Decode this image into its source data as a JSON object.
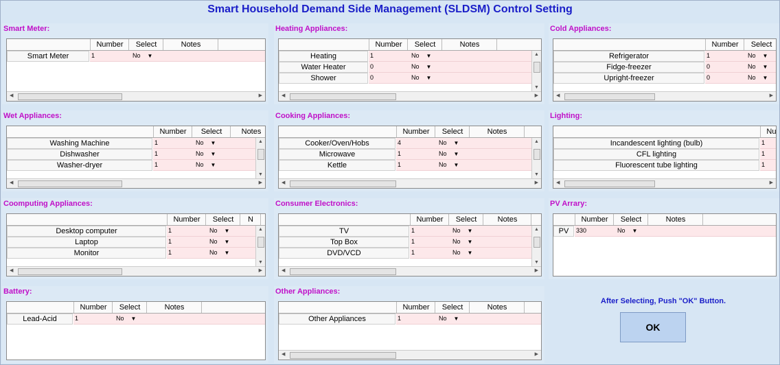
{
  "title": "Smart Household Demand Side Management (SLDSM) Control Setting",
  "columns": {
    "number": "Number",
    "select": "Select",
    "notes": "Notes"
  },
  "groups": [
    {
      "label": "Smart Meter:",
      "rows": [
        {
          "name": "Smart Meter",
          "number": "1",
          "select": "No"
        }
      ]
    },
    {
      "label": "Heating Appliances:",
      "rows": [
        {
          "name": "Heating",
          "number": "1",
          "select": "No"
        },
        {
          "name": "Water Heater",
          "number": "0",
          "select": "No"
        },
        {
          "name": "Shower",
          "number": "0",
          "select": "No"
        }
      ]
    },
    {
      "label": "Cold Appliances:",
      "rows": [
        {
          "name": "Refrigerator",
          "number": "1",
          "select": "No"
        },
        {
          "name": "Fidge-freezer",
          "number": "0",
          "select": "No"
        },
        {
          "name": "Upright-freezer",
          "number": "0",
          "select": "No"
        }
      ]
    },
    {
      "label": "Wet Appliances:",
      "rows": [
        {
          "name": "Washing Machine",
          "number": "1",
          "select": "No"
        },
        {
          "name": "Dishwasher",
          "number": "1",
          "select": "No"
        },
        {
          "name": "Washer-dryer",
          "number": "1",
          "select": "No"
        }
      ]
    },
    {
      "label": "Cooking Appliances:",
      "rows": [
        {
          "name": "Cooker/Oven/Hobs",
          "number": "4",
          "select": "No"
        },
        {
          "name": "Microwave",
          "number": "1",
          "select": "No"
        },
        {
          "name": "Kettle",
          "number": "1",
          "select": "No"
        }
      ]
    },
    {
      "label": "Lighting:",
      "rows": [
        {
          "name": "Incandescent lighting (bulb)",
          "number": "1",
          "select": ""
        },
        {
          "name": "CFL lighting",
          "number": "1",
          "select": ""
        },
        {
          "name": "Fluorescent tube lighting",
          "number": "1",
          "select": ""
        }
      ]
    },
    {
      "label": "Coomputing Appliances:",
      "rows": [
        {
          "name": "Desktop computer",
          "number": "1",
          "select": "No"
        },
        {
          "name": "Laptop",
          "number": "1",
          "select": "No"
        },
        {
          "name": "Monitor",
          "number": "1",
          "select": "No"
        }
      ]
    },
    {
      "label": "Consumer Electronics:",
      "rows": [
        {
          "name": "TV",
          "number": "1",
          "select": "No"
        },
        {
          "name": "Top Box",
          "number": "1",
          "select": "No"
        },
        {
          "name": "DVD/VCD",
          "number": "1",
          "select": "No"
        }
      ]
    },
    {
      "label": "PV Arrary:",
      "rows": [
        {
          "name": "PV",
          "number": "330",
          "select": "No"
        }
      ]
    },
    {
      "label": "Battery:",
      "rows": [
        {
          "name": "Lead-Acid",
          "number": "1",
          "select": "No"
        }
      ]
    },
    {
      "label": "Other Appliances:",
      "rows": [
        {
          "name": "Other Appliances",
          "number": "1",
          "select": "No"
        }
      ]
    }
  ],
  "lighting_number_header": "Num",
  "computing_notes_header": "N",
  "instruction": "After Selecting, Push \"OK\" Button.",
  "ok_label": "OK",
  "icons": {
    "dropdown": "dropdown-arrow-icon",
    "scroll_up": "scroll-up-icon",
    "scroll_down": "scroll-down-icon",
    "scroll_left": "scroll-left-icon",
    "scroll_right": "scroll-right-icon"
  },
  "colors": {
    "title": "#1a1ec8",
    "group_label": "#c010c8",
    "row_highlight": "#fde8ea",
    "background": "#d7e6f4"
  }
}
